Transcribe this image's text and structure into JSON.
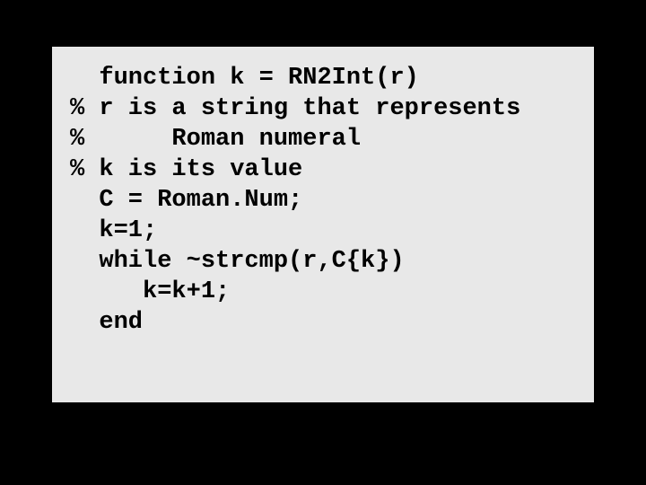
{
  "code": {
    "line1": "  function k = RN2Int(r)",
    "line2": "% r is a string that represents",
    "line3": "%      Roman numeral",
    "line4": "% k is its value",
    "line5": "",
    "line6": "  C = Roman.Num;",
    "line7": "  k=1;",
    "line8": "  while ~strcmp(r,C{k})",
    "line9": "     k=k+1;",
    "line10": "  end"
  }
}
